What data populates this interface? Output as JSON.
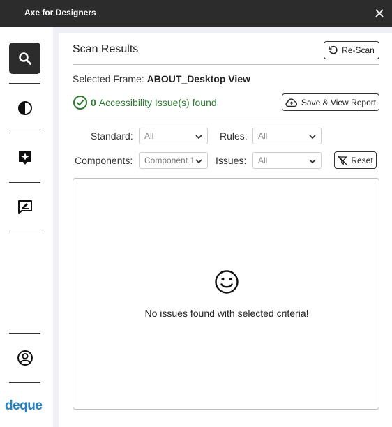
{
  "app": {
    "title": "Axe for Designers"
  },
  "sidebar": {
    "items": [
      {
        "name": "scan",
        "icon": "search-icon",
        "active": true
      },
      {
        "name": "contrast",
        "icon": "contrast-icon",
        "active": false
      },
      {
        "name": "annotate",
        "icon": "sparkle-note-icon",
        "active": false
      },
      {
        "name": "feedback",
        "icon": "chat-edit-icon",
        "active": false
      }
    ],
    "account_icon": "user-circle-icon",
    "logo": "deque"
  },
  "scan": {
    "title": "Scan Results",
    "rescan_label": "Re-Scan",
    "frame_prefix": "Selected Frame:",
    "frame_name": "ABOUT_Desktop View",
    "issue_count": "0",
    "issue_text": "Accessibility Issue(s) found",
    "save_report_label": "Save & View Report"
  },
  "filters": {
    "standard_label": "Standard:",
    "standard_value": "All",
    "rules_label": "Rules:",
    "rules_value": "All",
    "components_label": "Components:",
    "components_value": "Component 1",
    "issues_label": "Issues:",
    "issues_value": "All",
    "reset_label": "Reset"
  },
  "results": {
    "empty_message": "No issues found with selected criteria!"
  },
  "colors": {
    "success": "#2e7d32",
    "accent": "#2680c2",
    "titlebar": "#2c2c2c"
  }
}
